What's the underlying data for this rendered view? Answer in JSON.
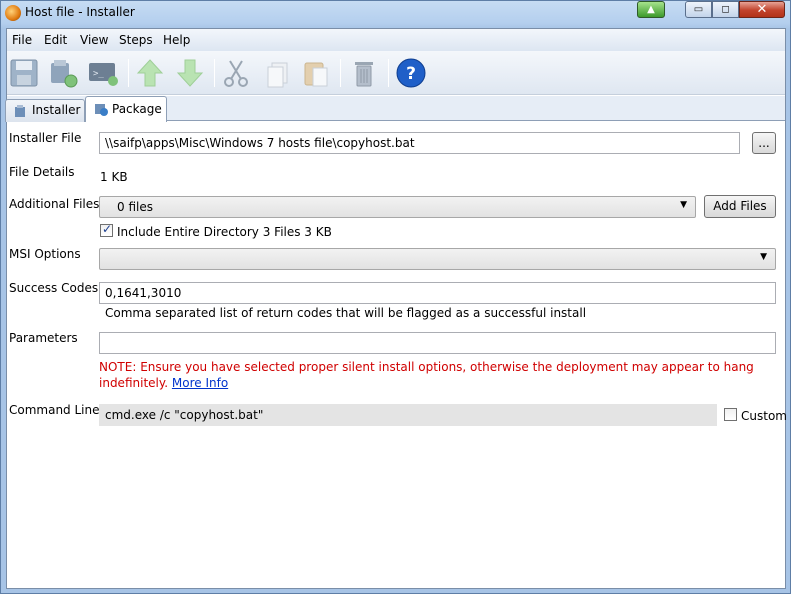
{
  "window": {
    "title": "Host file - Installer",
    "controls": {
      "minimize": "▭",
      "maximize": "◻",
      "close": "✕",
      "extra": "▲"
    }
  },
  "menu": {
    "items": [
      "File",
      "Edit",
      "View",
      "Steps",
      "Help"
    ]
  },
  "toolbar": {
    "icons": [
      "save-icon",
      "install-icon",
      "console-icon",
      "move-up-icon",
      "move-down-icon",
      "cut-icon",
      "copy-icon",
      "paste-icon",
      "delete-icon",
      "help-icon"
    ]
  },
  "tabs": [
    {
      "label": "Installer",
      "active": false
    },
    {
      "label": "Package",
      "active": true
    }
  ],
  "form": {
    "installer_file": {
      "label": "Installer File",
      "value": "\\\\saifp\\apps\\Misc\\Windows 7 hosts file\\copyhost.bat",
      "browse_label": "..."
    },
    "file_details": {
      "label": "File Details",
      "value": "1 KB"
    },
    "additional_files": {
      "label": "Additional Files",
      "selected": "0 files",
      "add_label": "Add Files"
    },
    "include_directory": {
      "label": "Include Entire Directory 3 Files  3 KB",
      "checked": true
    },
    "msi_options": {
      "label": "MSI Options",
      "selected": ""
    },
    "success_codes": {
      "label": "Success Codes",
      "value": "0,1641,3010",
      "hint": "Comma separated list of return codes that will be flagged as a successful install"
    },
    "parameters": {
      "label": "Parameters",
      "value": ""
    },
    "note": {
      "text": "NOTE: Ensure you have selected proper silent install options, otherwise the deployment may appear to hang indefinitely.",
      "link": "More Info"
    },
    "command_line": {
      "label": "Command Line",
      "value": "cmd.exe /c \"copyhost.bat\"",
      "custom_label": "Custom",
      "custom_checked": false
    }
  },
  "colors": {
    "note": "#d00000",
    "link": "#0033cc",
    "help": "#1f5fc8"
  }
}
